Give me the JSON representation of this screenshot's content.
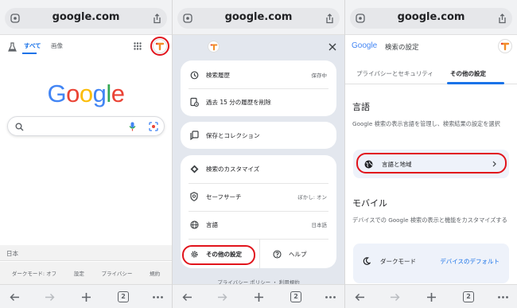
{
  "panel1": {
    "url": "google.com",
    "nav_all": "すべて",
    "nav_images": "画像",
    "logo_letters": [
      "G",
      "o",
      "o",
      "g",
      "l",
      "e"
    ],
    "logo_colors": [
      "#4285f4",
      "#ea4335",
      "#fbbc05",
      "#4285f4",
      "#34a853",
      "#ea4335"
    ],
    "footer_region": "日本",
    "footer_links": [
      "ダークモード: オフ",
      "設定",
      "プライバシー",
      "規約"
    ],
    "tab_count": "2"
  },
  "panel2": {
    "url": "google.com",
    "menu": {
      "history": "検索履歴",
      "history_status": "保存中",
      "delete_15": "過去 15 分の履歴を削除",
      "saves": "保存とコレクション",
      "customize": "検索のカスタマイズ",
      "safesearch": "セーフサーチ",
      "safesearch_status": "ぼかし: オン",
      "language": "言語",
      "language_value": "日本語",
      "more_settings": "その他の設定",
      "help": "ヘルプ",
      "footer": "プライバシー ポリシー ・ 利用規約"
    },
    "tab_count": "2"
  },
  "panel3": {
    "header_logo": "Google",
    "header_title": "検索の設定",
    "tabs": [
      "プライバシーとセキュリティ",
      "その他の設定"
    ],
    "lang_heading": "言語",
    "lang_desc": "Google 検索の表示言語を管理し、検索結果の設定を選択",
    "lang_region_btn": "言語と地域",
    "mobile_heading": "モバイル",
    "mobile_desc": "デバイスでの Google 検索の表示と機能をカスタマイズする",
    "darkmode_label": "ダークモード",
    "darkmode_value": "デバイスのデフォルト",
    "tab_count": "2"
  },
  "colors": {
    "accent_blue": "#1a73e8",
    "highlight_red": "#e1141c",
    "menu_bg": "#e3e7ee",
    "avatar_orange": "#f28c28"
  },
  "icons": [
    "site-settings-icon",
    "share-icon",
    "labs-flask-icon",
    "apps-grid-icon",
    "avatar-icon",
    "search-icon",
    "mic-icon",
    "lens-icon",
    "back-icon",
    "forward-icon",
    "new-tab-icon",
    "tabs-icon",
    "more-icon",
    "close-icon",
    "history-icon",
    "delete-history-icon",
    "saves-icon",
    "customize-icon",
    "safesearch-icon",
    "globe-icon",
    "gear-icon",
    "help-icon",
    "chevron-right-icon",
    "moon-icon"
  ]
}
